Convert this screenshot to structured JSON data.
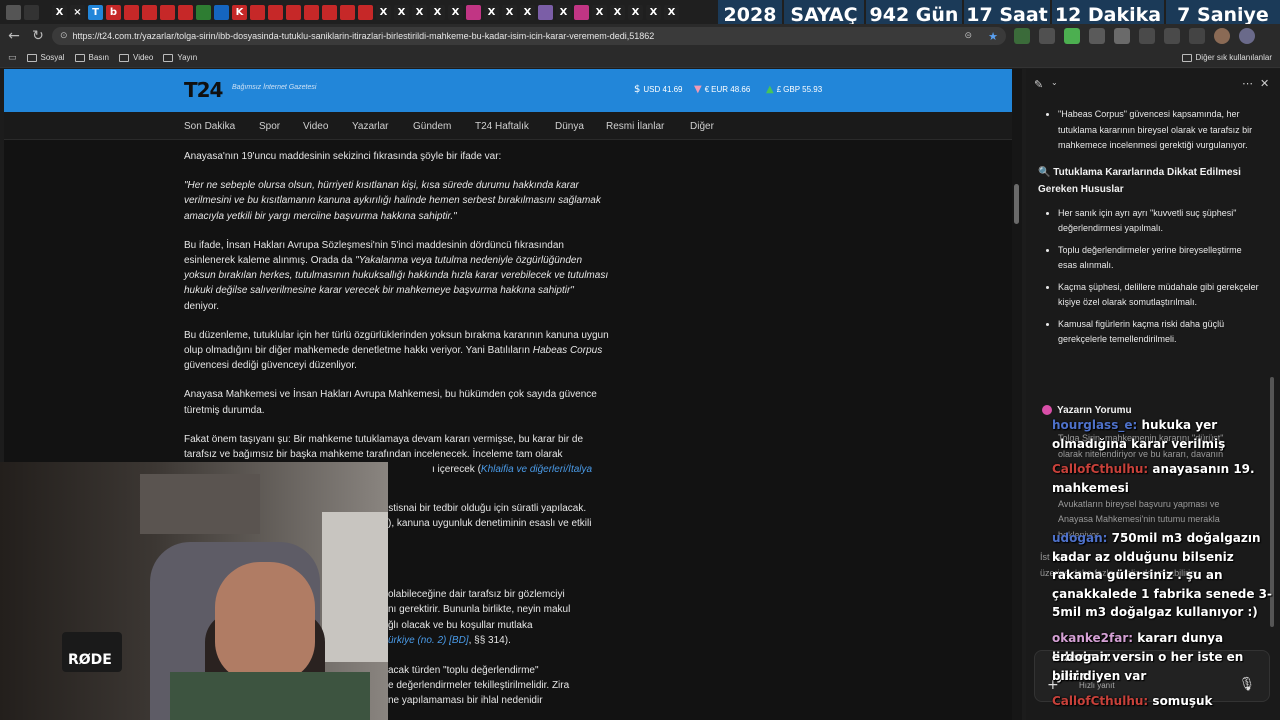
{
  "overlay": {
    "year": "2028",
    "sayac": "SAYAÇ",
    "gun": "942 Gün",
    "saat": "17 Saat",
    "dakika": "12 Dakika",
    "saniye": "7 Saniye"
  },
  "browser": {
    "url": "https://t24.com.tr/yazarlar/tolga-sirin/ibb-dosyasinda-tutuklu-saniklarin-itirazlari-birlestirildi-mahkeme-bu-kadar-isim-icin-karar-veremem-dedi,51862",
    "bookmarks": [
      "Sosyal",
      "Basın",
      "Video",
      "Yayın"
    ],
    "other_bookmarks": "Diğer sık kullanılanlar"
  },
  "site": {
    "logo": "T24",
    "tagline": "Bağımsız İnternet Gazetesi",
    "usd": "USD 41.69",
    "eur": "EUR 48.66",
    "gbp": "GBP 55.93",
    "nav": [
      "Son Dakika",
      "Spor",
      "Video",
      "Yazarlar",
      "Gündem",
      "T24 Haftalık",
      "Dünya",
      "Resmi İlanlar",
      "Diğer"
    ]
  },
  "article": {
    "p1": "Anayasa'nın 19'uncu maddesinin sekizinci fıkrasında şöyle bir ifade var:",
    "p2": "\"Her ne sebeple olursa olsun, hürriyeti kısıtlanan kişi, kısa sürede durumu hakkında karar verilmesini ve bu kısıtlamanın kanuna aykırılığı halinde hemen serbest bırakılmasını sağlamak amacıyla yetkili bir yargı merciine başvurma hakkına sahiptir.\"",
    "p3a": "Bu ifade, İnsan Hakları Avrupa Sözleşmesi'nin 5'inci maddesinin dördüncü fıkrasından esinlenerek kaleme alınmış. Orada da ",
    "p3b": "\"Yakalanma veya tutulma nedeniyle özgürlüğünden yoksun bırakılan herkes, tutulmasının hukuksallığı hakkında hızla karar verebilecek ve tutulması hukuki değilse salıverilmesine karar verecek bir mahkemeye başvurma hakkına sahiptir\"",
    "p3c": " deniyor.",
    "p4a": "Bu düzenleme, tutuklular için her türlü özgürlüklerinden yoksun bırakma kararının kanuna uygun olup olmadığını bir diğer mahkemede denetletme hakkı veriyor. Yani Batılıların ",
    "p4b": "Habeas Corpus",
    "p4c": " güvencesi dediği güvenceyi düzenliyor.",
    "p5": "Anayasa Mahkemesi ve İnsan Hakları Avrupa Mahkemesi, bu hükümden çok sayıda güvence türetmiş durumda.",
    "p6a": "Fakat önem taşıyanı şu: Bir mahkeme tutuklamaya devam kararı vermişse, bu karar bir de tarafsız ve bağımsız bir başka mahkeme tarafından incelenecek. İnceleme tam olarak",
    "p6b": "ı içerecek (",
    "p6link": "Khlaifia ve diğerleri/İtalya [BD], §",
    "frag1": "istisnai bir tedbir olduğu için süratli yapılacak.",
    "frag2": "), kanuna uygunluk denetiminin esaslı ve etkili",
    "frag3": "olabileceğine dair tarafsız bir gözlemciyi",
    "frag4": "nı gerektirir. Bununla birlikte, neyin makul",
    "frag5": "ğlı olacak ve bu koşullar mutlaka",
    "frag6link": "ürkiye (no. 2)",
    "frag6b": " [BD]",
    "frag6c": ", §§ 314).",
    "frag7": "acak türden \"toplu değerlendirme\"",
    "frag8": "e değerlendirmeler tekilleştirilmelidir. Zira",
    "frag9": "ne yapılamaması bir ihlal nedenidir"
  },
  "sidebar": {
    "b1": "\"Habeas Corpus\" güvencesi kapsamında, her tutuklama kararının bireysel olarak ve tarafsız bir mahkemece incelenmesi gerektiği vurgulanıyor.",
    "h1": "🔍 Tutuklama Kararlarında Dikkat Edilmesi Gereken Hususlar",
    "items": [
      "Her sanık için ayrı ayrı \"kuvvetli suç şüphesi\" değerlendirmesi yapılmalı.",
      "Toplu değerlendirmeler yerine bireyselleştirme esas alınmalı.",
      "Kaçma şüphesi, delillere müdahale gibi gerekçeler kişiye özel olarak somutlaştırılmalı.",
      "Kamusal figürlerin kaçma riski daha güçlü gerekçelerle temellendirilmeli."
    ],
    "h2": "Yazarın Yorumu",
    "faded1": "Tolga Şirin, mahkemenin kararını \"dürüst\"",
    "faded2": "olarak nitelendiriyor ve bu kararı, davanın",
    "faded3": "Avukatların bireysel başvuru yapması ve",
    "faded4": "Anayasa Mahkemesi'nin tutumu merakla",
    "faded5": "bekleniyor.",
    "faded6": "İst",
    "faded7": "üzerine daha fazla analiz de yapabilirim.",
    "input_label": "Hızlı yanıt"
  },
  "chat": [
    {
      "user": "hourglass_e:",
      "text": "hukuka yer"
    },
    {
      "user": "",
      "text": "olmadığına karar verilmiş"
    },
    {
      "user": "CallofCthulhu:",
      "text": "anayasanın 19."
    },
    {
      "user": "",
      "text": "mahkemesi"
    },
    {
      "user": "udogan:",
      "text": "750mil m3 doğalgazın ne"
    },
    {
      "user": "",
      "text": "kadar az olduğunu bilseniz"
    },
    {
      "user": "",
      "text": "rakama gülersiniz . şu an"
    },
    {
      "user": "",
      "text": "çanakkalede 1 fabrika senede 3-"
    },
    {
      "user": "",
      "text": "5mil m3 doğalgaz kullanıyor :)"
    },
    {
      "user": "okanke2far:",
      "text": "kararı dunya liderimiz"
    },
    {
      "user": "",
      "text": "erdogan versin o her iste en iyisini"
    },
    {
      "user": "",
      "text": "bilir diyen var"
    },
    {
      "user": "CallofCthulhu:",
      "text": "somuşuk"
    }
  ],
  "cam": {
    "mic_brand": "RØDE"
  }
}
